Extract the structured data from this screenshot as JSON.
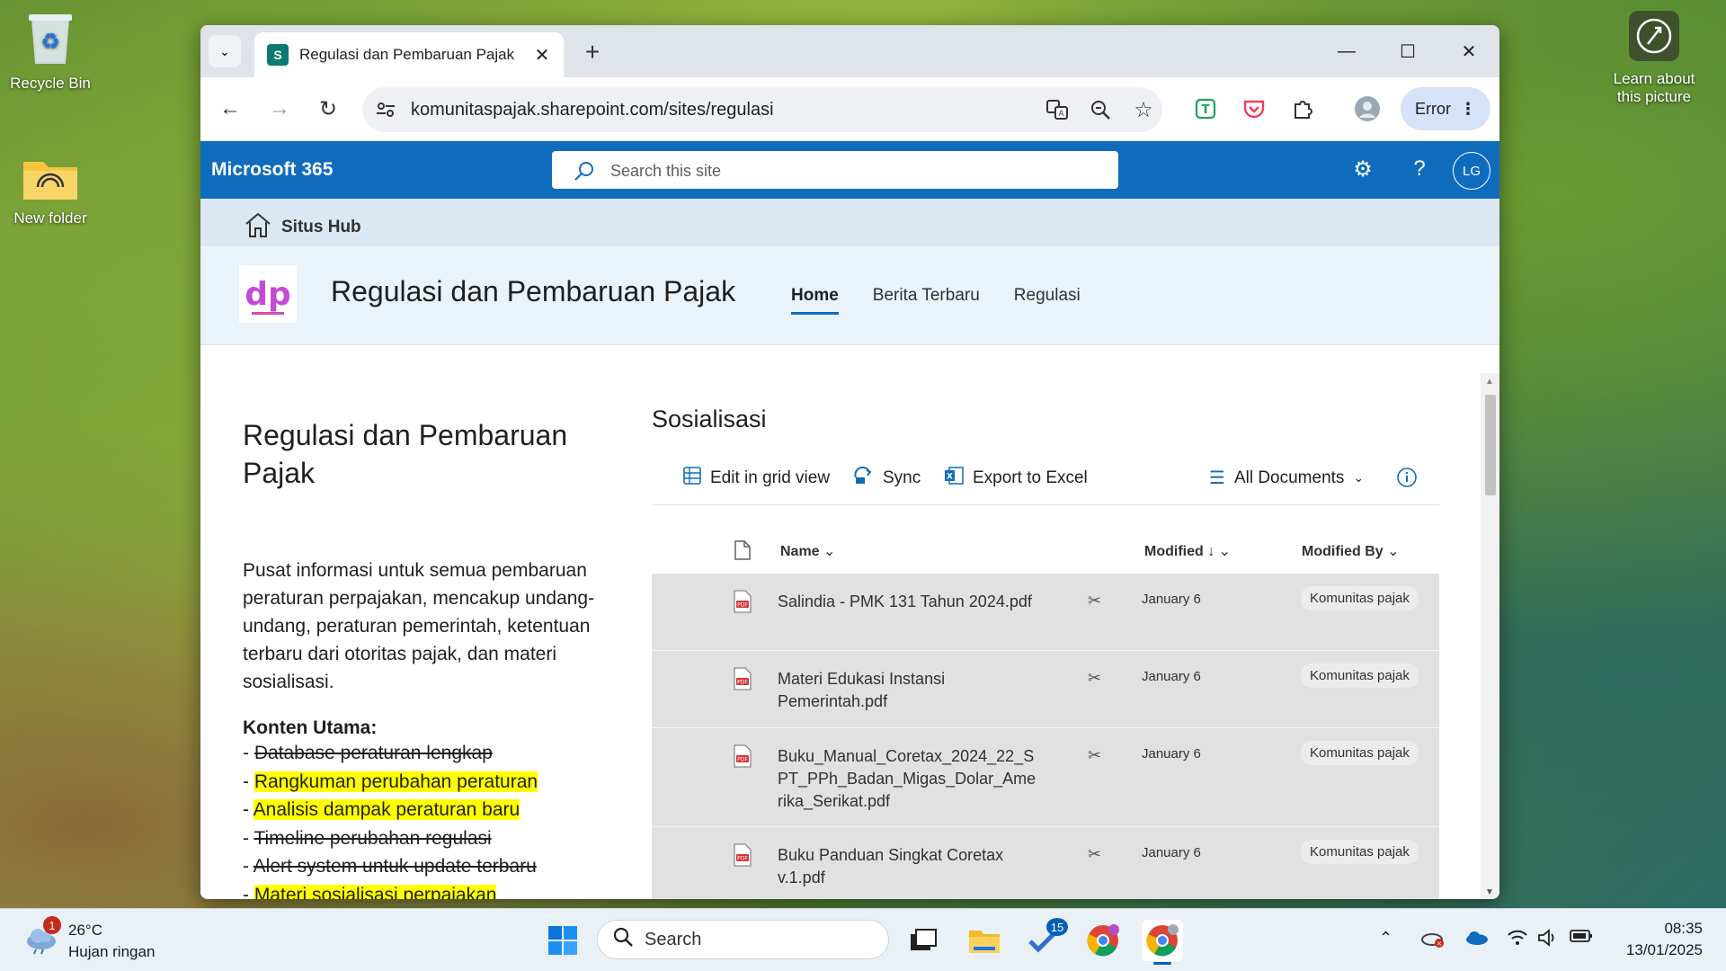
{
  "desktop": {
    "icons": [
      {
        "label": "Recycle Bin",
        "icon": "recycle-bin-icon"
      },
      {
        "label": "New folder",
        "icon": "folder-icon"
      }
    ],
    "learn_label": "Learn about this picture"
  },
  "browser": {
    "tab_title": "Regulasi dan Pembaruan Pajak",
    "url": "komunitaspajak.sharepoint.com/sites/regulasi",
    "profile_button": "Error"
  },
  "m365": {
    "brand": "Microsoft 365",
    "search_placeholder": "Search this site",
    "avatar": "LG"
  },
  "hub": {
    "label": "Situs Hub"
  },
  "site": {
    "title": "Regulasi dan Pembaruan Pajak",
    "logo_text": "dp",
    "nav": [
      "Home",
      "Berita Terbaru",
      "Regulasi"
    ]
  },
  "left": {
    "heading": "Regulasi dan Pembaruan Pajak",
    "intro": "Pusat informasi untuk semua pembaruan peraturan perpajakan, mencakup undang-undang, peraturan pemerintah, ketentuan terbaru dari otoritas pajak, dan materi sosialisasi.",
    "konten_label": "Konten Utama:",
    "items": [
      {
        "text": "Database peraturan lengkap",
        "style": "strike"
      },
      {
        "text": "Rangkuman perubahan peraturan",
        "style": "highlight"
      },
      {
        "text": "Analisis dampak peraturan baru",
        "style": "highlight"
      },
      {
        "text": "Timeline perubahan regulasi",
        "style": "strike"
      },
      {
        "text": "Alert system untuk update terbaru",
        "style": "strike"
      },
      {
        "text": "Materi sosialisasi perpajakan",
        "style": "highlight"
      }
    ]
  },
  "library": {
    "title": "Sosialisasi",
    "commands": {
      "edit_grid": "Edit in grid view",
      "sync": "Sync",
      "export": "Export to Excel",
      "view": "All Documents"
    },
    "columns": {
      "name": "Name",
      "modified": "Modified",
      "modified_by": "Modified By"
    },
    "rows": [
      {
        "name": "Salindia - PMK 131 Tahun 2024.pdf",
        "modified": "January 6",
        "by": "Komunitas pajak"
      },
      {
        "name": "Materi Edukasi Instansi Pemerintah.pdf",
        "modified": "January 6",
        "by": "Komunitas pajak"
      },
      {
        "name": "Buku_Manual_Coretax_2024_22_SPT_PPh_Badan_Migas_Dolar_Amerika_Serikat.pdf",
        "modified": "January 6",
        "by": "Komunitas pajak"
      },
      {
        "name": "Buku Panduan Singkat Coretax v.1.pdf",
        "modified": "January 6",
        "by": "Komunitas pajak"
      }
    ]
  },
  "taskbar": {
    "weather_temp": "26°C",
    "weather_desc": "Hujan ringan",
    "weather_badge": "1",
    "search_label": "Search",
    "todo_badge": "15",
    "time": "08:35",
    "date": "13/01/2025"
  },
  "colors": {
    "m365_blue": "#0f6cbd",
    "highlight": "#ffff00",
    "row_bg": "#e1e1e1"
  }
}
